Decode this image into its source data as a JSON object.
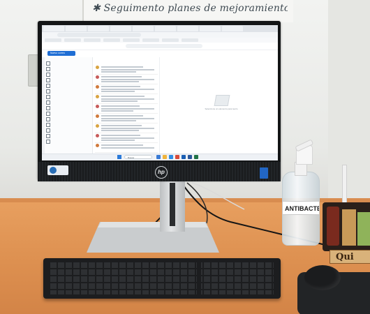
{
  "scene": {
    "whiteboard_text": "✱ Seguimento planes de mejoramiento",
    "sanitizer_label": "ANTIBACTE",
    "nameplate_text": "Qui",
    "monitor_logo": "hp"
  },
  "screen": {
    "new_button_label": "Nuevo correo",
    "empty_message": "Seleccione un elemento para leerlo",
    "taskbar_search": "Buscar"
  },
  "colors": {
    "desk": "#dd9050",
    "wall": "#eceeec",
    "monitor_bezel": "#131516",
    "keyboard": "#1c1d1f",
    "accent_blue": "#1f6ed4"
  }
}
